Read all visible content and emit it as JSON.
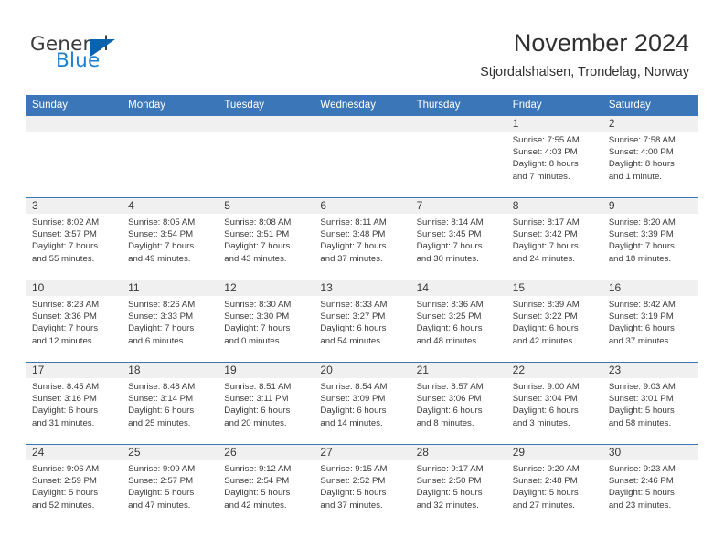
{
  "brand": {
    "name_part1": "General",
    "name_part2": "Blue",
    "accent_color": "#1b7fd4",
    "triangle_color": "#0b63ad"
  },
  "header": {
    "title": "November 2024",
    "location": "Stjordalshalsen, Trondelag, Norway"
  },
  "theme": {
    "header_row_color": "#3b77b8",
    "daynum_band_color": "#f0f0f0",
    "text_color": "#3a3a3a"
  },
  "weekday_headers": [
    "Sunday",
    "Monday",
    "Tuesday",
    "Wednesday",
    "Thursday",
    "Friday",
    "Saturday"
  ],
  "weeks": [
    [
      {
        "day": "",
        "info": ""
      },
      {
        "day": "",
        "info": ""
      },
      {
        "day": "",
        "info": ""
      },
      {
        "day": "",
        "info": ""
      },
      {
        "day": "",
        "info": ""
      },
      {
        "day": "1",
        "info": "Sunrise: 7:55 AM\nSunset: 4:03 PM\nDaylight: 8 hours\nand 7 minutes."
      },
      {
        "day": "2",
        "info": "Sunrise: 7:58 AM\nSunset: 4:00 PM\nDaylight: 8 hours\nand 1 minute."
      }
    ],
    [
      {
        "day": "3",
        "info": "Sunrise: 8:02 AM\nSunset: 3:57 PM\nDaylight: 7 hours\nand 55 minutes."
      },
      {
        "day": "4",
        "info": "Sunrise: 8:05 AM\nSunset: 3:54 PM\nDaylight: 7 hours\nand 49 minutes."
      },
      {
        "day": "5",
        "info": "Sunrise: 8:08 AM\nSunset: 3:51 PM\nDaylight: 7 hours\nand 43 minutes."
      },
      {
        "day": "6",
        "info": "Sunrise: 8:11 AM\nSunset: 3:48 PM\nDaylight: 7 hours\nand 37 minutes."
      },
      {
        "day": "7",
        "info": "Sunrise: 8:14 AM\nSunset: 3:45 PM\nDaylight: 7 hours\nand 30 minutes."
      },
      {
        "day": "8",
        "info": "Sunrise: 8:17 AM\nSunset: 3:42 PM\nDaylight: 7 hours\nand 24 minutes."
      },
      {
        "day": "9",
        "info": "Sunrise: 8:20 AM\nSunset: 3:39 PM\nDaylight: 7 hours\nand 18 minutes."
      }
    ],
    [
      {
        "day": "10",
        "info": "Sunrise: 8:23 AM\nSunset: 3:36 PM\nDaylight: 7 hours\nand 12 minutes."
      },
      {
        "day": "11",
        "info": "Sunrise: 8:26 AM\nSunset: 3:33 PM\nDaylight: 7 hours\nand 6 minutes."
      },
      {
        "day": "12",
        "info": "Sunrise: 8:30 AM\nSunset: 3:30 PM\nDaylight: 7 hours\nand 0 minutes."
      },
      {
        "day": "13",
        "info": "Sunrise: 8:33 AM\nSunset: 3:27 PM\nDaylight: 6 hours\nand 54 minutes."
      },
      {
        "day": "14",
        "info": "Sunrise: 8:36 AM\nSunset: 3:25 PM\nDaylight: 6 hours\nand 48 minutes."
      },
      {
        "day": "15",
        "info": "Sunrise: 8:39 AM\nSunset: 3:22 PM\nDaylight: 6 hours\nand 42 minutes."
      },
      {
        "day": "16",
        "info": "Sunrise: 8:42 AM\nSunset: 3:19 PM\nDaylight: 6 hours\nand 37 minutes."
      }
    ],
    [
      {
        "day": "17",
        "info": "Sunrise: 8:45 AM\nSunset: 3:16 PM\nDaylight: 6 hours\nand 31 minutes."
      },
      {
        "day": "18",
        "info": "Sunrise: 8:48 AM\nSunset: 3:14 PM\nDaylight: 6 hours\nand 25 minutes."
      },
      {
        "day": "19",
        "info": "Sunrise: 8:51 AM\nSunset: 3:11 PM\nDaylight: 6 hours\nand 20 minutes."
      },
      {
        "day": "20",
        "info": "Sunrise: 8:54 AM\nSunset: 3:09 PM\nDaylight: 6 hours\nand 14 minutes."
      },
      {
        "day": "21",
        "info": "Sunrise: 8:57 AM\nSunset: 3:06 PM\nDaylight: 6 hours\nand 8 minutes."
      },
      {
        "day": "22",
        "info": "Sunrise: 9:00 AM\nSunset: 3:04 PM\nDaylight: 6 hours\nand 3 minutes."
      },
      {
        "day": "23",
        "info": "Sunrise: 9:03 AM\nSunset: 3:01 PM\nDaylight: 5 hours\nand 58 minutes."
      }
    ],
    [
      {
        "day": "24",
        "info": "Sunrise: 9:06 AM\nSunset: 2:59 PM\nDaylight: 5 hours\nand 52 minutes."
      },
      {
        "day": "25",
        "info": "Sunrise: 9:09 AM\nSunset: 2:57 PM\nDaylight: 5 hours\nand 47 minutes."
      },
      {
        "day": "26",
        "info": "Sunrise: 9:12 AM\nSunset: 2:54 PM\nDaylight: 5 hours\nand 42 minutes."
      },
      {
        "day": "27",
        "info": "Sunrise: 9:15 AM\nSunset: 2:52 PM\nDaylight: 5 hours\nand 37 minutes."
      },
      {
        "day": "28",
        "info": "Sunrise: 9:17 AM\nSunset: 2:50 PM\nDaylight: 5 hours\nand 32 minutes."
      },
      {
        "day": "29",
        "info": "Sunrise: 9:20 AM\nSunset: 2:48 PM\nDaylight: 5 hours\nand 27 minutes."
      },
      {
        "day": "30",
        "info": "Sunrise: 9:23 AM\nSunset: 2:46 PM\nDaylight: 5 hours\nand 23 minutes."
      }
    ]
  ]
}
